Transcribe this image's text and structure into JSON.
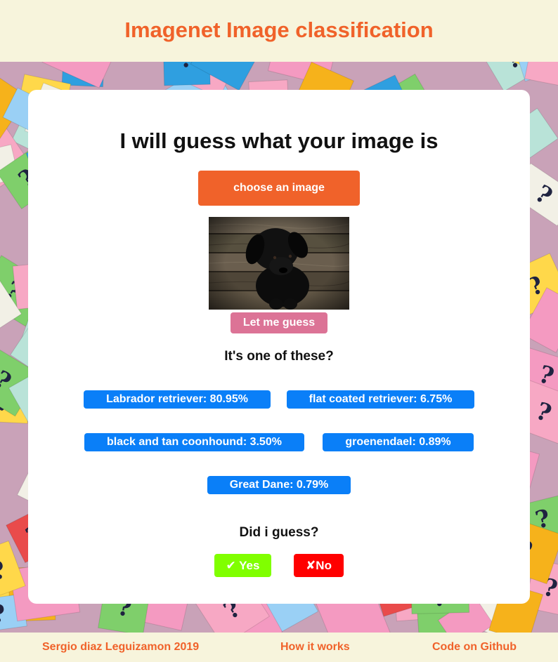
{
  "colors": {
    "accent": "#f0622a",
    "header_bg": "#f7f4dc",
    "guess_button": "#dc7396",
    "prediction": "#0a7ff8",
    "yes": "#80ff00",
    "no": "#ff0000"
  },
  "header": {
    "title": "Imagenet Image classification"
  },
  "main": {
    "title": "I will guess what your image is",
    "choose_label": "choose an image",
    "guess_label": "Let me guess",
    "question": "It's one of these?",
    "predictions": [
      {
        "label": "Labrador retriever: 80.95%"
      },
      {
        "label": "flat coated retriever: 6.75%"
      },
      {
        "label": "black and tan coonhound: 3.50%"
      },
      {
        "label": "groenendael: 0.89%"
      },
      {
        "label": "Great Dane: 0.79%"
      }
    ],
    "feedback_question": "Did i guess?",
    "yes_label": "✔ Yes",
    "no_label": "✘No"
  },
  "footer": {
    "author": "Sergio diaz Leguizamon 2019",
    "how_it_works": "How it works",
    "github": "Code on Github"
  }
}
